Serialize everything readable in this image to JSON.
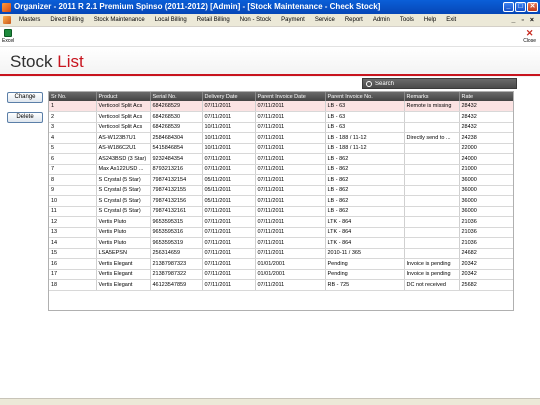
{
  "window": {
    "title": "Organizer - 2011 R 2.1 Premium Spinso (2011-2012) [Admin] - [Stock Maintenance - Check Stock]"
  },
  "menu": [
    "Masters",
    "Direct Billing",
    "Stock Maintenance",
    "Local Billing",
    "Retail Billing",
    "Non - Stock",
    "Payment",
    "Service",
    "Report",
    "Admin",
    "Tools",
    "Help",
    "Exit"
  ],
  "toolbar": {
    "excel_label": "Excel",
    "close_label": "Close"
  },
  "page": {
    "title_part1": "Stock",
    "title_part2": "List"
  },
  "search": {
    "placeholder": "Search"
  },
  "actions": {
    "change_label": "Change",
    "delete_label": "Delete"
  },
  "colors": {
    "accent": "#c8141e",
    "titlebar": "#0a5fd8",
    "header_bg": "#555555",
    "selected_row": "#fbe3e3"
  },
  "table": {
    "columns": [
      "Sr No.",
      "Product",
      "Serial No.",
      "Delivery Date",
      "Parent Invoice Date",
      "Parent Invoice No.",
      "Remarks",
      "Rate"
    ],
    "rows": [
      [
        "1",
        "Verticool Split Acs",
        "684268529",
        "07/11/2011",
        "07/11/2011",
        "LB - 63",
        "Remote is missing",
        "28432"
      ],
      [
        "2",
        "Verticool Split Acs",
        "684268530",
        "07/11/2011",
        "07/11/2011",
        "LB - 63",
        "",
        "28432"
      ],
      [
        "3",
        "Verticool Split Acs",
        "684268539",
        "10/11/2011",
        "07/11/2011",
        "LB - 63",
        "",
        "28432"
      ],
      [
        "4",
        "AS-W123B7U1",
        "2584684304",
        "10/11/2011",
        "07/11/2011",
        "LB - 188 / 11-12",
        "Directly send to ...",
        "24238"
      ],
      [
        "5",
        "AS-W186C2U1",
        "5415846854",
        "10/11/2011",
        "07/11/2011",
        "LB - 188 / 11-12",
        "",
        "22000"
      ],
      [
        "6",
        "AS243BSD (3 Star)",
        "9232484354",
        "07/11/2011",
        "07/11/2011",
        "LB - 862",
        "",
        "24000"
      ],
      [
        "7",
        "Max As122USD ...",
        "8793213216",
        "07/11/2011",
        "07/11/2011",
        "LB - 862",
        "",
        "21000"
      ],
      [
        "8",
        "S Crystal (5 Star)",
        "79874132154",
        "05/11/2011",
        "07/11/2011",
        "LB - 862",
        "",
        "36000"
      ],
      [
        "9",
        "S Crystal (5 Star)",
        "79874132155",
        "05/11/2011",
        "07/11/2011",
        "LB - 862",
        "",
        "36000"
      ],
      [
        "10",
        "S Crystal (5 Star)",
        "79874132156",
        "05/11/2011",
        "07/11/2011",
        "LB - 862",
        "",
        "36000"
      ],
      [
        "11",
        "S Crystal (5 Star)",
        "79874132161",
        "07/11/2011",
        "07/11/2011",
        "LB - 862",
        "",
        "36000"
      ],
      [
        "12",
        "Vertis Pluto",
        "9653595315",
        "07/11/2011",
        "07/11/2011",
        "LTK - 864",
        "",
        "21036"
      ],
      [
        "13",
        "Vertis Pluto",
        "9653595316",
        "07/11/2011",
        "07/11/2011",
        "LTK - 864",
        "",
        "21036"
      ],
      [
        "14",
        "Vertis Pluto",
        "9653595319",
        "07/11/2011",
        "07/11/2011",
        "LTK - 864",
        "",
        "21036"
      ],
      [
        "15",
        "LSA5EPSN",
        "256314659",
        "07/11/2011",
        "07/11/2011",
        "2010-11 / 365",
        "",
        "24682"
      ],
      [
        "16",
        "Vertis Elegant",
        "21387987323",
        "07/11/2011",
        "01/01/2001",
        "Pending",
        "Invoice is pending",
        "20342"
      ],
      [
        "17",
        "Vertis Elegant",
        "21387987322",
        "07/11/2011",
        "01/01/2001",
        "Pending",
        "Invoice is pending",
        "20342"
      ],
      [
        "18",
        "Vertis Elegant",
        "46123547859",
        "07/11/2011",
        "07/11/2011",
        "RB - 725",
        "DC not received",
        "25682"
      ]
    ]
  }
}
